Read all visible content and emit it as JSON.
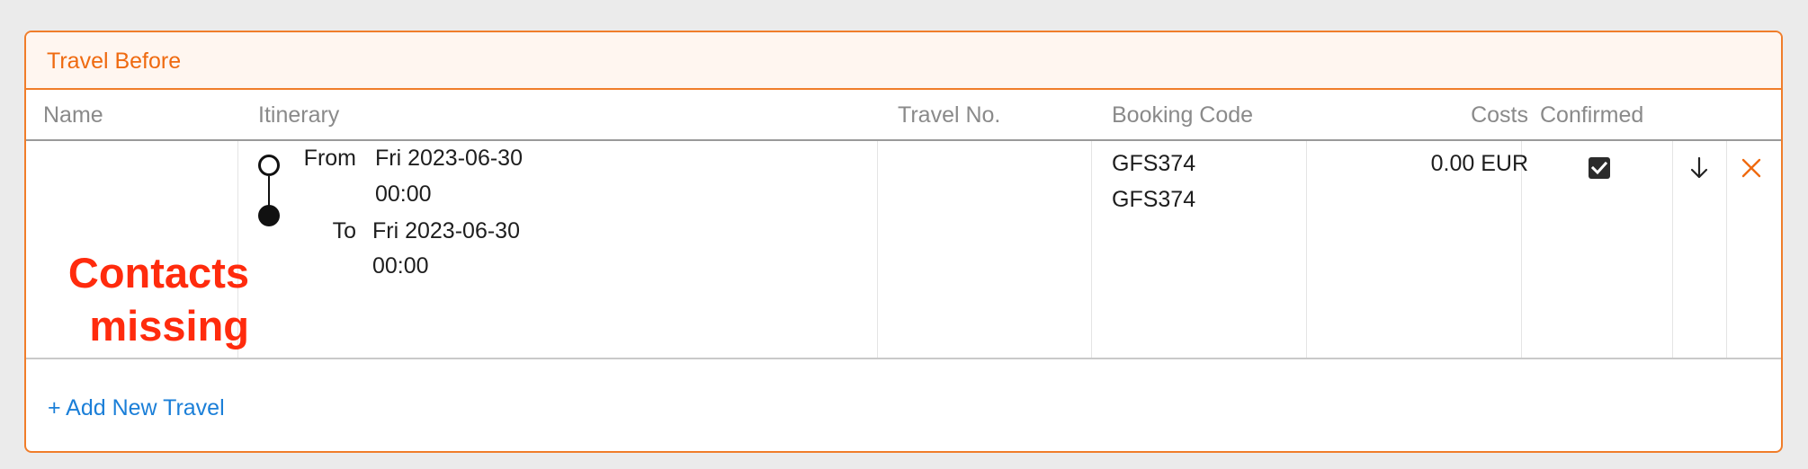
{
  "panel": {
    "title": "Travel Before",
    "accent_color": "#f07d2a"
  },
  "table": {
    "columns": {
      "name": "Name",
      "itinerary": "Itinerary",
      "travel_no": "Travel No.",
      "booking_code": "Booking Code",
      "costs": "Costs",
      "confirmed": "Confirmed"
    },
    "rows": [
      {
        "name_warning_line1": "Contacts",
        "name_warning_line2": "missing",
        "from_label": "From",
        "from_date": "Fri 2023-06-30",
        "from_time": "00:00",
        "to_label": "To",
        "to_date": "Fri 2023-06-30",
        "to_time": "00:00",
        "travel_no": "",
        "booking_code_1": "GFS374",
        "booking_code_2": "GFS374",
        "costs": "0.00 EUR",
        "confirmed": true,
        "move_icon": "arrow-down-icon",
        "delete_icon": "close-icon"
      }
    ]
  },
  "footer": {
    "add_label": "+ Add New Travel"
  }
}
